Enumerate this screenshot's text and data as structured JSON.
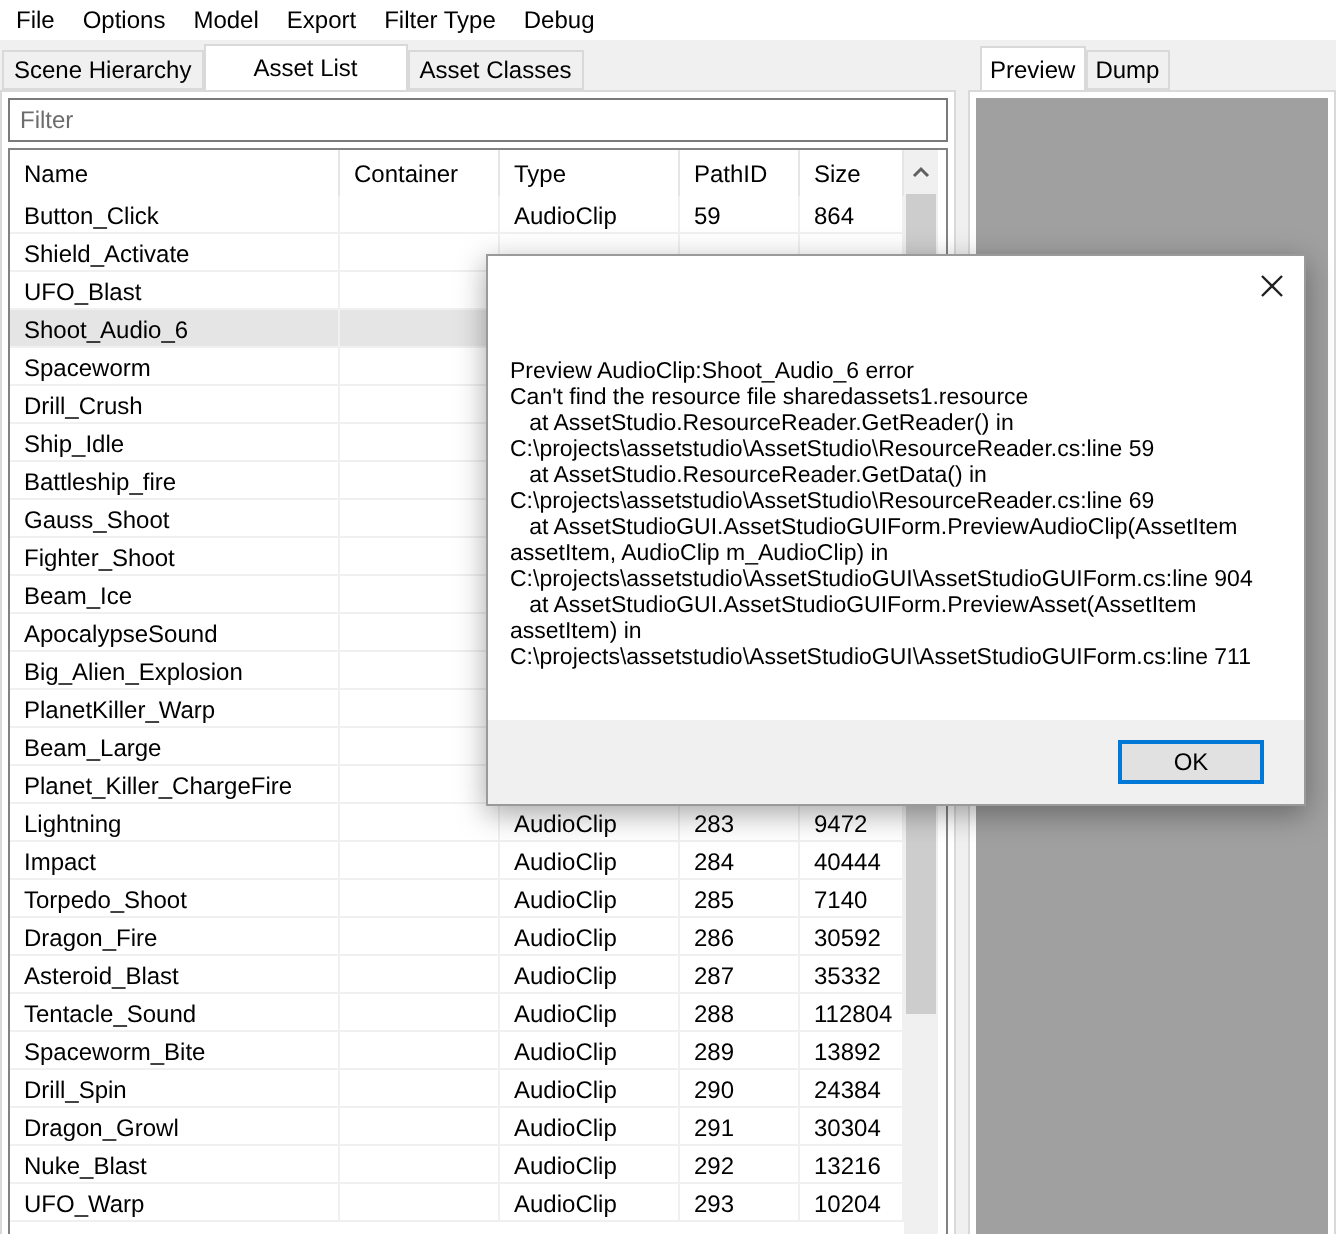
{
  "menu": [
    "File",
    "Options",
    "Model",
    "Export",
    "Filter Type",
    "Debug"
  ],
  "left_tabs": [
    {
      "label": "Scene Hierarchy",
      "selected": false
    },
    {
      "label": "Asset List",
      "selected": true
    },
    {
      "label": "Asset Classes",
      "selected": false
    }
  ],
  "filter": {
    "placeholder": "Filter"
  },
  "table": {
    "columns": [
      "Name",
      "Container",
      "Type",
      "PathID",
      "Size"
    ],
    "rows": [
      {
        "name": "Button_Click",
        "type": "AudioClip",
        "path_id": "59",
        "size": "864",
        "selected": false
      },
      {
        "name": "Shield_Activate",
        "selected": false
      },
      {
        "name": "UFO_Blast",
        "selected": false
      },
      {
        "name": "Shoot_Audio_6",
        "selected": true
      },
      {
        "name": "Spaceworm",
        "selected": false
      },
      {
        "name": "Drill_Crush",
        "selected": false
      },
      {
        "name": "Ship_Idle",
        "selected": false
      },
      {
        "name": "Battleship_fire",
        "selected": false
      },
      {
        "name": "Gauss_Shoot",
        "selected": false
      },
      {
        "name": "Fighter_Shoot",
        "selected": false
      },
      {
        "name": "Beam_Ice",
        "selected": false
      },
      {
        "name": "ApocalypseSound",
        "selected": false
      },
      {
        "name": "Big_Alien_Explosion",
        "selected": false
      },
      {
        "name": "PlanetKiller_Warp",
        "selected": false
      },
      {
        "name": "Beam_Large",
        "selected": false
      },
      {
        "name": "Planet_Killer_ChargeFire",
        "selected": false
      },
      {
        "name": "Lightning",
        "type": "AudioClip",
        "path_id": "283",
        "size": "9472",
        "selected": false
      },
      {
        "name": "Impact",
        "type": "AudioClip",
        "path_id": "284",
        "size": "40444",
        "selected": false
      },
      {
        "name": "Torpedo_Shoot",
        "type": "AudioClip",
        "path_id": "285",
        "size": "7140",
        "selected": false
      },
      {
        "name": "Dragon_Fire",
        "type": "AudioClip",
        "path_id": "286",
        "size": "30592",
        "selected": false
      },
      {
        "name": "Asteroid_Blast",
        "type": "AudioClip",
        "path_id": "287",
        "size": "35332",
        "selected": false
      },
      {
        "name": "Tentacle_Sound",
        "type": "AudioClip",
        "path_id": "288",
        "size": "112804",
        "selected": false
      },
      {
        "name": "Spaceworm_Bite",
        "type": "AudioClip",
        "path_id": "289",
        "size": "13892",
        "selected": false
      },
      {
        "name": "Drill_Spin",
        "type": "AudioClip",
        "path_id": "290",
        "size": "24384",
        "selected": false
      },
      {
        "name": "Dragon_Growl",
        "type": "AudioClip",
        "path_id": "291",
        "size": "30304",
        "selected": false
      },
      {
        "name": "Nuke_Blast",
        "type": "AudioClip",
        "path_id": "292",
        "size": "13216",
        "selected": false
      },
      {
        "name": "UFO_Warp",
        "type": "AudioClip",
        "path_id": "293",
        "size": "10204",
        "selected": false
      }
    ]
  },
  "right_tabs": [
    {
      "label": "Preview",
      "selected": true
    },
    {
      "label": "Dump",
      "selected": false
    }
  ],
  "dialog": {
    "message": "Preview AudioClip:Shoot_Audio_6 error\nCan't find the resource file sharedassets1.resource\n   at AssetStudio.ResourceReader.GetReader() in\nC:\\projects\\assetstudio\\AssetStudio\\ResourceReader.cs:line 59\n   at AssetStudio.ResourceReader.GetData() in\nC:\\projects\\assetstudio\\AssetStudio\\ResourceReader.cs:line 69\n   at AssetStudioGUI.AssetStudioGUIForm.PreviewAudioClip(AssetItem\nassetItem, AudioClip m_AudioClip) in\nC:\\projects\\assetstudio\\AssetStudioGUI\\AssetStudioGUIForm.cs:line 904\n   at AssetStudioGUI.AssetStudioGUIForm.PreviewAsset(AssetItem\nassetItem) in\nC:\\projects\\assetstudio\\AssetStudioGUI\\AssetStudioGUIForm.cs:line 711",
    "button": "OK"
  }
}
